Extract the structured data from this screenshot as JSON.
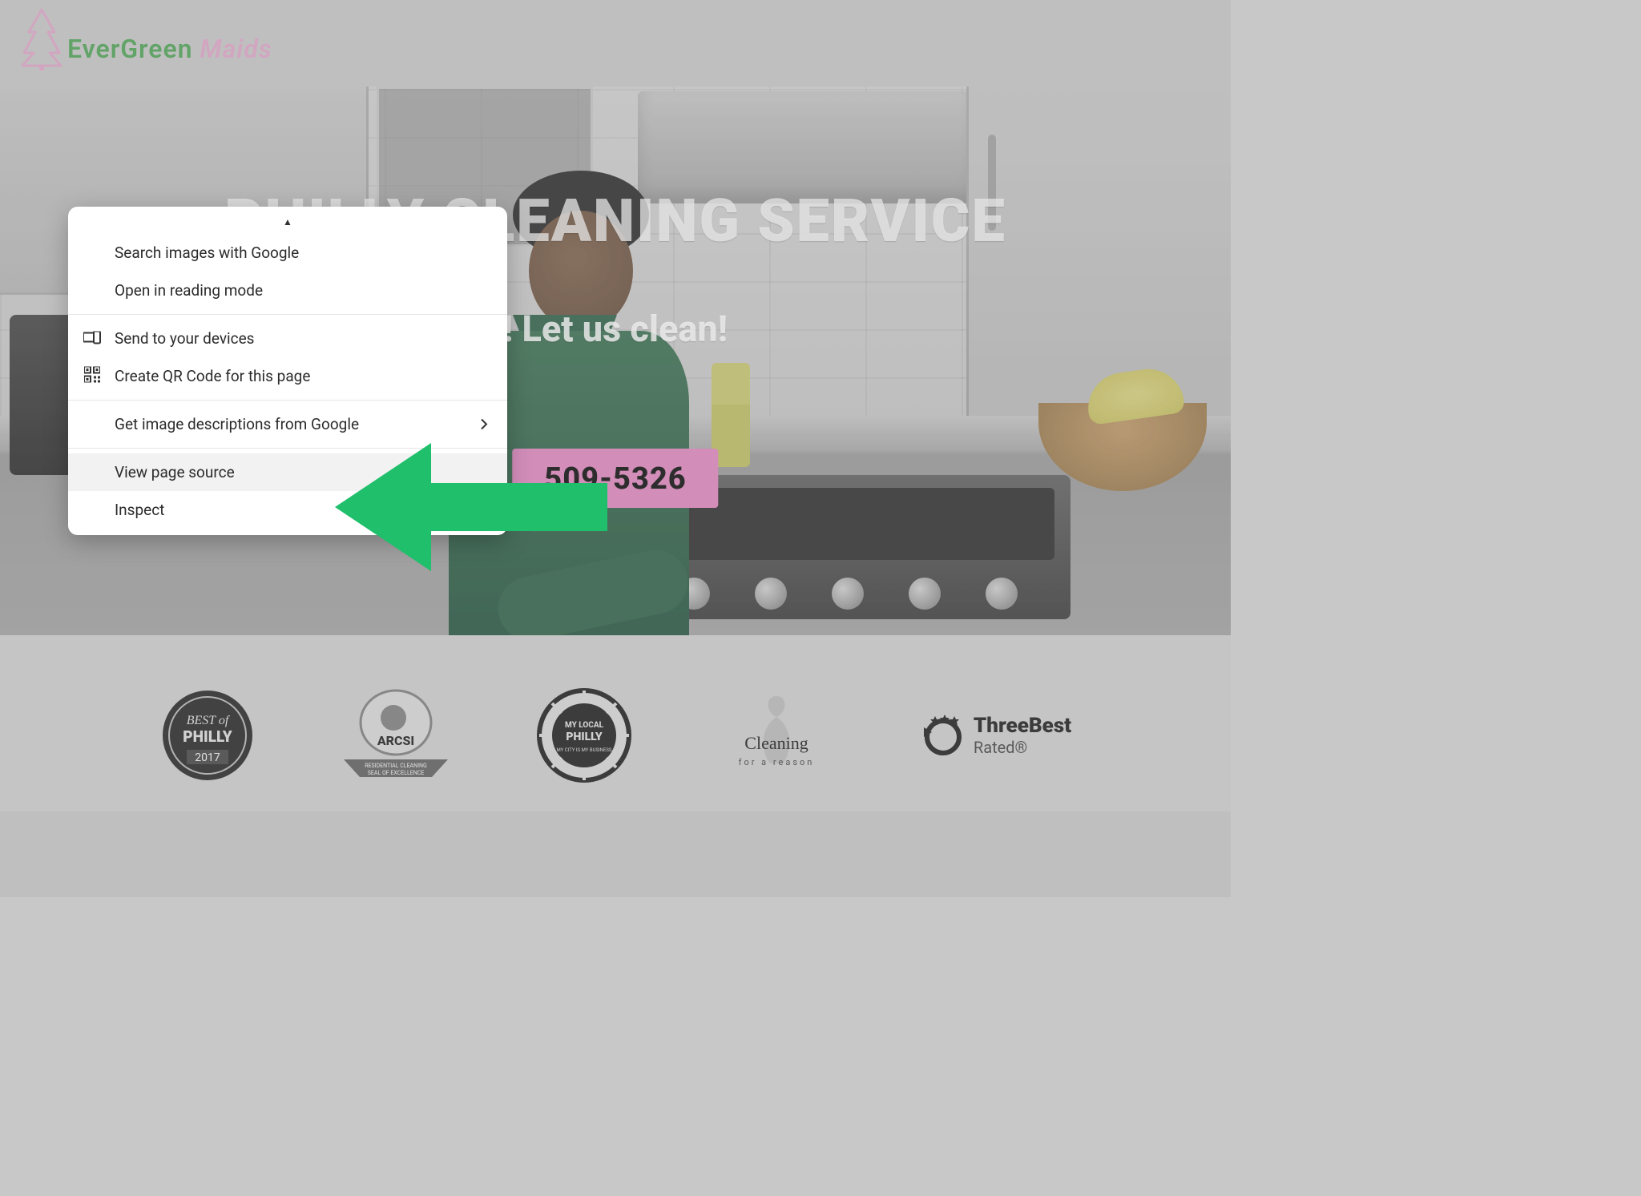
{
  "logo": {
    "part1": "EverGreen",
    "part2": " Maids"
  },
  "hero": {
    "title": "PHILLY CLEANING SERVICE",
    "tagline_suffix": "! Let us clean!",
    "cta_suffix": "509-5326"
  },
  "context_menu": {
    "items": [
      {
        "label": "Search images with Google",
        "icon": "",
        "submenu": false
      },
      {
        "label": "Open in reading mode",
        "icon": "",
        "submenu": false
      }
    ],
    "group2": [
      {
        "label": "Send to your devices",
        "icon": "devices"
      },
      {
        "label": "Create QR Code for this page",
        "icon": "qr"
      }
    ],
    "group3": [
      {
        "label": "Get image descriptions from Google",
        "submenu": true
      }
    ],
    "group4": [
      {
        "label": "View page source",
        "highlight": true
      },
      {
        "label": "Inspect"
      }
    ]
  },
  "badges": [
    {
      "name": "Best of Philly 2017",
      "line1": "BEST of",
      "line2": "PHILLY",
      "line3": "2017"
    },
    {
      "name": "ARCSI",
      "line1": "ARCSI",
      "line2": "RESIDENTIAL CLEANING",
      "line3": "SEAL OF EXCELLENCE"
    },
    {
      "name": "My Local Philly",
      "line1": "MY LOCAL",
      "line2": "PHILLY",
      "line3": "MY CITY IS MY BUSINESS"
    },
    {
      "name": "Cleaning for a Reason",
      "line1": "Cleaning",
      "line2": "for a reason"
    },
    {
      "name": "ThreeBest Rated",
      "line1": "ThreeBest",
      "line2": "Rated®"
    }
  ]
}
